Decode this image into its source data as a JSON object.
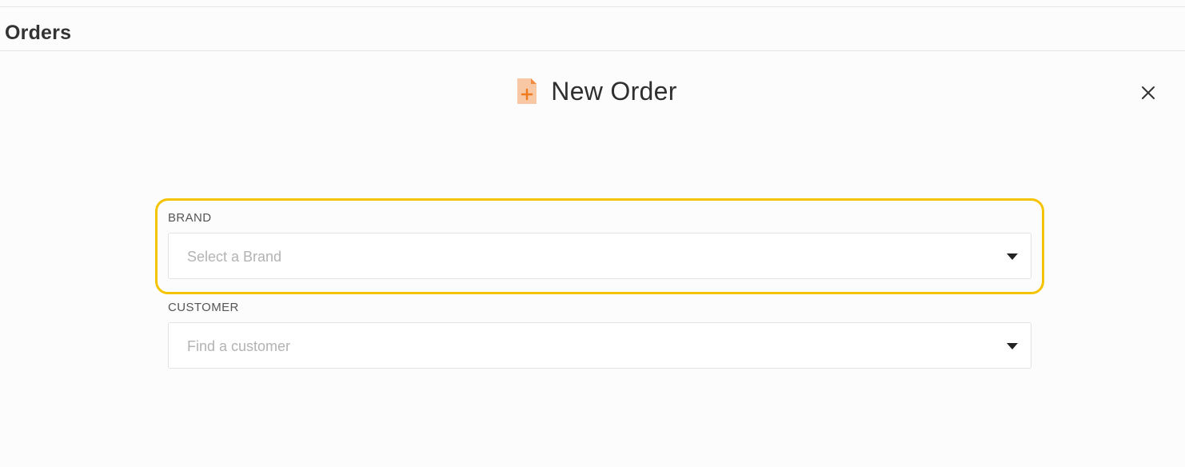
{
  "page": {
    "title": "Orders"
  },
  "modal": {
    "title": "New Order",
    "icon": "document-plus-icon",
    "close_icon": "close-icon"
  },
  "form": {
    "brand": {
      "label": "BRAND",
      "placeholder": "Select a Brand",
      "icon": "caret-down-icon"
    },
    "customer": {
      "label": "CUSTOMER",
      "placeholder": "Find a customer",
      "icon": "caret-down-icon"
    }
  },
  "colors": {
    "accent_orange": "#f08a3e",
    "icon_light_orange": "#f8c7a4",
    "highlight_yellow": "#f5c400"
  }
}
